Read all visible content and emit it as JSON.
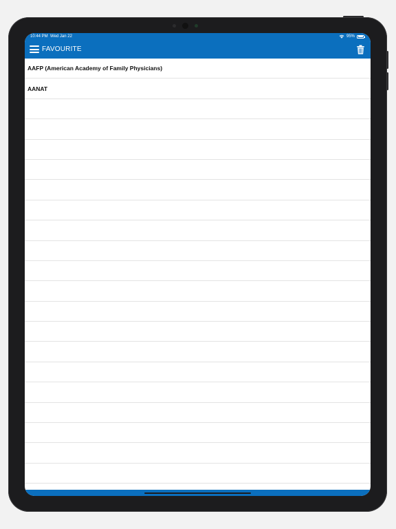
{
  "status_bar": {
    "time": "10:44 PM",
    "date": "Wed Jan 22",
    "battery": "95%",
    "battery_level": 0.95
  },
  "header": {
    "title": "FAVOURITE",
    "menu_icon": "hamburger-menu-icon",
    "delete_icon": "trash-icon",
    "color": "#0b6fbe"
  },
  "favourites": [
    {
      "label": "AAFP (American Academy of Family Physicians)"
    },
    {
      "label": "AANAT"
    },
    {
      "label": ""
    },
    {
      "label": ""
    },
    {
      "label": ""
    },
    {
      "label": ""
    },
    {
      "label": ""
    },
    {
      "label": ""
    },
    {
      "label": ""
    },
    {
      "label": ""
    },
    {
      "label": ""
    },
    {
      "label": ""
    },
    {
      "label": ""
    },
    {
      "label": ""
    },
    {
      "label": ""
    },
    {
      "label": ""
    },
    {
      "label": ""
    },
    {
      "label": ""
    },
    {
      "label": ""
    },
    {
      "label": ""
    },
    {
      "label": ""
    },
    {
      "label": ""
    }
  ]
}
